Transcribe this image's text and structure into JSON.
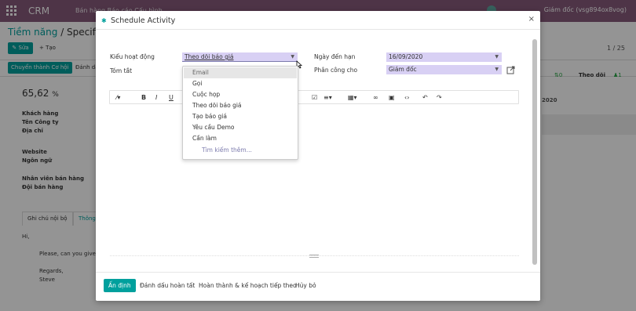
{
  "app": {
    "brand": "CRM",
    "menu_text": "Bán hàng   Báo cáo   Cấu hình",
    "user": "Giám đốc (vsg894ox8vog)"
  },
  "background": {
    "breadcrumb_link": "Tiềm năng",
    "breadcrumb_sep": " / ",
    "breadcrumb_current": "Specification",
    "edit_label": "Sửa",
    "create_label": "+ Tạo",
    "pager": "1 / 25",
    "convert_label": "Chuyển thành Cơ hội",
    "mark_label": "Đánh dấu",
    "stat_zero": "0",
    "stat_follow": "Theo dõi",
    "stat_one": "1",
    "probability": "65,62",
    "probability_unit": "%",
    "fields": [
      "Khách hàng",
      "Tên Công ty",
      "Địa chỉ",
      "Website",
      "Ngôn ngữ",
      "Nhân viên bán hàng",
      "Đội bán hàng"
    ],
    "tab_internal": "Ghi chú nội bộ",
    "tab_info": "Thông",
    "chat_greeting": "Hi,",
    "chat_line": "Please, can you give c",
    "chat_regards": "Regards,",
    "chat_name": "Steve",
    "year": "2020"
  },
  "modal": {
    "title": "Schedule Activity",
    "close": "×",
    "activity_type_label": "Kiểu hoạt động",
    "activity_type_value": "Theo dõi báo giá",
    "summary_label": "Tóm tắt",
    "due_date_label": "Ngày đến hạn",
    "due_date_value": "16/09/2020",
    "assigned_label": "Phân công cho",
    "assigned_value": "Giám đốc",
    "footer": {
      "schedule": "Ấn định",
      "mark_done": "Đánh dấu hoàn tất",
      "done_next": "Hoàn thành & kế hoạch tiếp theo",
      "discard": "Hủy bỏ"
    }
  },
  "dropdown": {
    "items": [
      "Email",
      "Gọi",
      "Cuộc họp",
      "Theo dõi báo giá",
      "Tạo báo giá",
      "Yêu cầu Demo",
      "Cần làm"
    ],
    "more": "Tìm kiếm thêm...",
    "highlighted_index": 0
  },
  "toolbar": {
    "bold": "B",
    "italic": "I",
    "underline": "U"
  },
  "colors": {
    "brand_purple": "#875a7b",
    "teal": "#00a09d",
    "select_bg": "#d8d0f4",
    "link_purple": "#7c7bad"
  }
}
